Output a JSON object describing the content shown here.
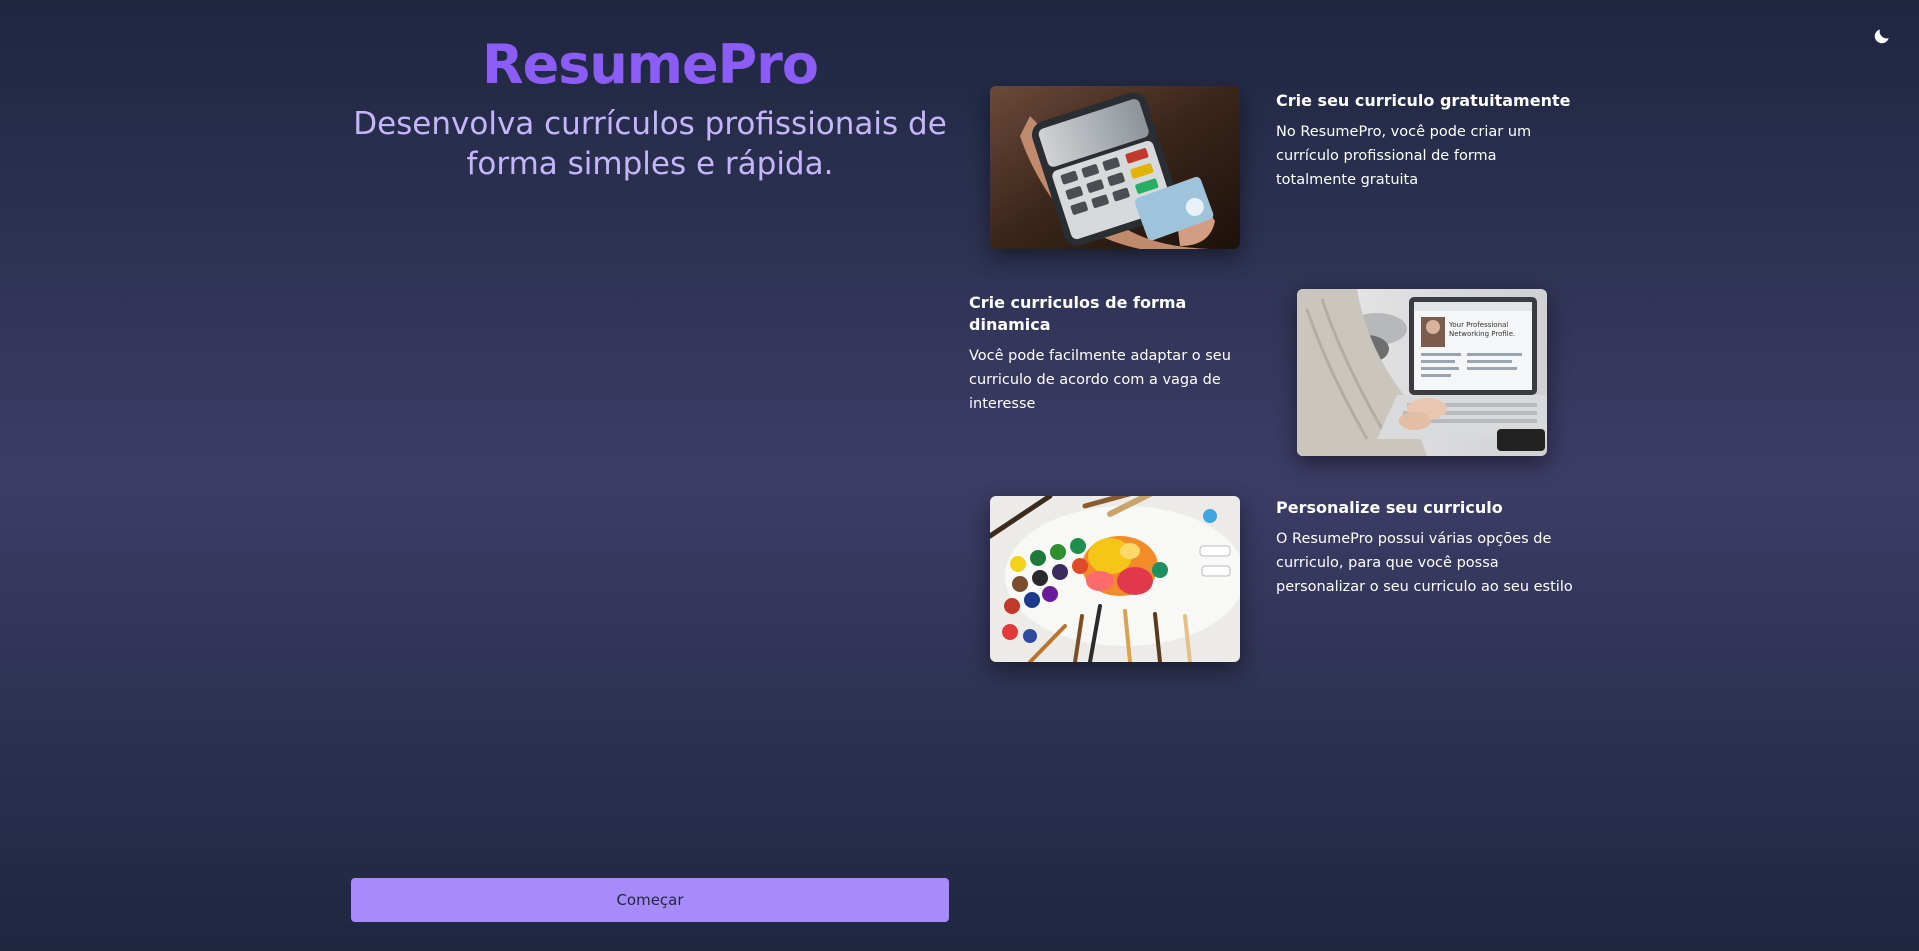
{
  "app": {
    "title": "ResumePro",
    "tagline": "Desenvolva currículos profissionais de forma simples e rápida."
  },
  "header": {
    "theme_toggle_icon": "moon-icon"
  },
  "features": [
    {
      "title": "Crie seu curriculo gratuitamente",
      "description": "No ResumePro, você pode criar um currículo profissional de forma totalmente gratuita",
      "image_icon": "card-payment-image"
    },
    {
      "title": "Crie curriculos de forma dinamica",
      "description": "Você pode facilmente adaptar o seu curriculo de acordo com a vaga de interesse",
      "image_icon": "laptop-profile-image",
      "image_text": "Your Professional Networking Profile."
    },
    {
      "title": "Personalize seu curriculo",
      "description": "O ResumePro possui várias opções de curriculo, para que você possa personalizar o seu curriculo ao seu estilo",
      "image_icon": "paint-palette-image"
    }
  ],
  "actions": {
    "start_label": "Começar"
  },
  "colors": {
    "brand": "#8b5cf6",
    "tagline": "#c4b5fd",
    "button": "#a78bfa",
    "bg_dark": "#1f2640",
    "bg_mid": "#3d3c66"
  }
}
